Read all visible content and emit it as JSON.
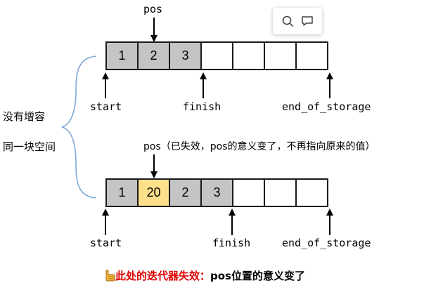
{
  "top_array": {
    "pointer_label": "pos",
    "cells": [
      "1",
      "2",
      "3",
      "",
      "",
      "",
      ""
    ],
    "labels": {
      "start": "start",
      "finish": "finish",
      "end": "end_of_storage"
    }
  },
  "bottom_array": {
    "pointer_label": "pos（已失效，pos的意义变了，不再指向原来的值）",
    "cells": [
      "1",
      "20",
      "2",
      "3",
      "",
      "",
      ""
    ],
    "labels": {
      "start": "start",
      "finish": "finish",
      "end": "end_of_storage"
    }
  },
  "side_note": {
    "line1": "没有增容",
    "line2": "同一块空间"
  },
  "bottom_note": {
    "red_text": "此处的迭代器失效：",
    "black_text": "pos位置的意义变了",
    "icon": "pointing-hand-icon"
  },
  "toolbar": {
    "icons": [
      "search-icon",
      "comment-icon"
    ]
  },
  "colors": {
    "filled": "#c4c4c4",
    "highlight": "#ffe08a",
    "warning": "#e00000"
  }
}
